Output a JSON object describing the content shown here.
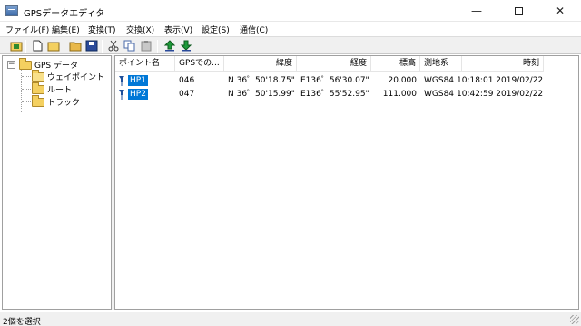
{
  "window": {
    "title": "GPSデータエディタ",
    "minimize_glyph": "—",
    "close_glyph": "✕"
  },
  "menu": [
    {
      "label": "ファイル(F)"
    },
    {
      "label": "編集(E)"
    },
    {
      "label": "変換(T)"
    },
    {
      "label": "交換(X)"
    },
    {
      "label": "表示(V)"
    },
    {
      "label": "設定(S)"
    },
    {
      "label": "通信(C)"
    }
  ],
  "toolbar": {
    "buttons": [
      {
        "name": "up-folder-icon",
        "color": "#2d8a2d"
      },
      {
        "name": "new-file-icon",
        "color": "#ffffff"
      },
      {
        "name": "new-folder-icon",
        "color": "#f4d060"
      },
      {
        "name": "open-folder-icon",
        "color": "#e8b84a"
      },
      {
        "name": "save-icon",
        "color": "#2a4a9a"
      },
      {
        "name": "cut-icon",
        "color": "#3a3a3a"
      },
      {
        "name": "copy-icon",
        "color": "#4a6aa8"
      },
      {
        "name": "paste-icon",
        "color": "#8a8a8a"
      },
      {
        "name": "upload-icon",
        "color": "#1e9a3a"
      },
      {
        "name": "download-icon",
        "color": "#1e9a3a"
      }
    ]
  },
  "tree": {
    "root": {
      "label": "GPS データ",
      "toggle": "−"
    },
    "children": [
      {
        "label": "ウェイポイント"
      },
      {
        "label": "ルート"
      },
      {
        "label": "トラック"
      }
    ]
  },
  "list": {
    "columns": [
      "ポイント名",
      "GPSでの...",
      "緯度",
      "経度",
      "標高",
      "測地系",
      "時刻"
    ],
    "rows": [
      {
        "name": "HP1",
        "gps_name": "046",
        "lat": "N 36゜50'18.75\"",
        "lon": "E136゜56'30.07\"",
        "alt": "20.000",
        "datum": "WGS84",
        "time": "10:18:01 2019/02/22"
      },
      {
        "name": "HP2",
        "gps_name": "047",
        "lat": "N 36゜50'15.99\"",
        "lon": "E136゜55'52.95\"",
        "alt": "111.000",
        "datum": "WGS84",
        "time": "10:42:59 2019/02/22"
      }
    ]
  },
  "status": {
    "text": "2個を選択"
  },
  "colors": {
    "selection": "#0078d7",
    "waypoint_pin": "#1f4f9a"
  }
}
